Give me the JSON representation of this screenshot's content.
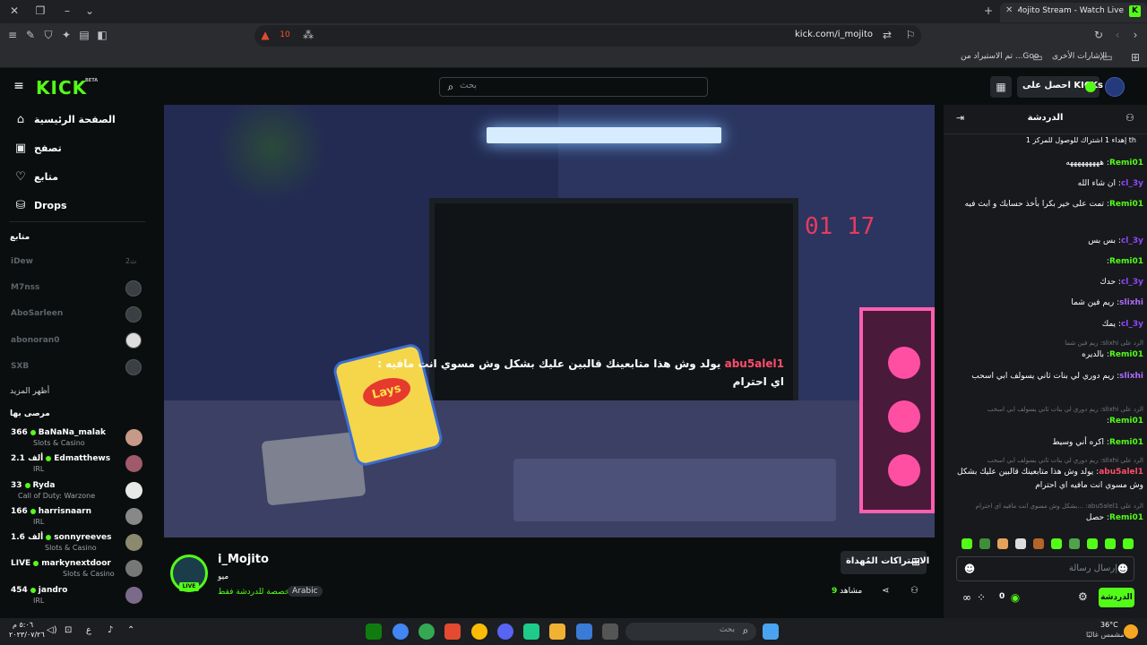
{
  "browser": {
    "tab_title": "i_Mojito Stream - Watch Live",
    "url": "kick.com/i_mojito",
    "shield_count": "10",
    "bookmarks": [
      "الإشارات الأخرى",
      "تم الاستيراد من ...Goo"
    ]
  },
  "header": {
    "logo": "KICK",
    "logo_badge": "BETA",
    "search_placeholder": "بحث",
    "get_kicks_label": "احصل على KICKs"
  },
  "sidebar": {
    "nav": [
      {
        "label": "الصفحة الرئيسية",
        "icon": "home-icon"
      },
      {
        "label": "تصفح",
        "icon": "browse-icon"
      },
      {
        "label": "متابع",
        "icon": "heart-icon"
      },
      {
        "label": "Drops",
        "icon": "drops-icon"
      }
    ],
    "following_heading": "متابع",
    "following": [
      {
        "name": "iDew",
        "status": "2ث"
      },
      {
        "name": "M7nss"
      },
      {
        "name": "AboSarleen"
      },
      {
        "name": "abonoran0"
      },
      {
        "name": "SXB"
      }
    ],
    "show_more": "أظهر المزيد",
    "recommended_heading": "مرصى بها",
    "recommended": [
      {
        "count": "366",
        "name": "BaNaNa_malak",
        "category": "Slots & Casino"
      },
      {
        "count": "2.1 ألف",
        "name": "Edmatthews",
        "category": "IRL"
      },
      {
        "count": "33",
        "name": "Ryda",
        "category": "Call of Duty: Warzone"
      },
      {
        "count": "166",
        "name": "harrisnaarn",
        "category": "IRL"
      },
      {
        "count": "1.6 ألف",
        "name": "sonnyreeves",
        "category": "Slots & Casino"
      },
      {
        "count": "LIVE",
        "name": "markynextdoor",
        "category": "Slots & Casino"
      },
      {
        "count": "454",
        "name": "jandro",
        "category": "IRL"
      }
    ]
  },
  "video": {
    "overlay_user": "abu5alel1",
    "overlay_text": "يولد وش هذا متابعينك قالبين عليك بشكل وش مسوي انت مافيه :",
    "overlay_text2": "اي احترام",
    "clock": "01 17",
    "chips_brand": "Lays"
  },
  "stream": {
    "name": "i_Mojito",
    "category": "ميو",
    "live_label": "LIVE",
    "chat_mode": "مخصصة للدردشة فقط",
    "language": "Arabic",
    "gift_label": "الاشتراكات المُهداة",
    "viewers_count": "9",
    "viewers_label": "مشاهد"
  },
  "chat": {
    "title": "الدردشة",
    "pinned": "th إهداء 1 اشتراك للوصول للمركز 1",
    "messages": [
      {
        "user": "Remi01",
        "color": "#53fc18",
        "text": "هههههههههه"
      },
      {
        "user": "cl_3y",
        "color": "#9147ff",
        "text": "ان شاء الله"
      },
      {
        "user": "Remi01",
        "color": "#53fc18",
        "text": "تمت على خير بكرا بأخذ حسابك و ابث فيه"
      },
      {
        "user": "cl_3y",
        "color": "#9147ff",
        "text": "بس بس"
      },
      {
        "user": "Remi01",
        "color": "#53fc18",
        "text": ""
      },
      {
        "user": "cl_3y",
        "color": "#9147ff",
        "text": "حدك"
      },
      {
        "user": "slixhi",
        "color": "#b06bff",
        "text": "ريم فين شما"
      },
      {
        "user": "cl_3y",
        "color": "#9147ff",
        "text": "يمك"
      },
      {
        "user": "Remi01",
        "color": "#53fc18",
        "text": "بالديره"
      },
      {
        "user": "slixhi",
        "color": "#b06bff",
        "text": "ريم دوري لي بنات ثاني يسولف ابي اسحب"
      },
      {
        "user": "Remi01",
        "color": "#53fc18",
        "text": ""
      },
      {
        "user": "Remi01",
        "color": "#53fc18",
        "text": "اكره أني وسيط"
      },
      {
        "user": "abu5alel1",
        "color": "#ff4d6b",
        "text": "يولد وش هذا متابعينك قالبين عليك بشكل وش مسوي انت مافيه اي احترام"
      },
      {
        "user": "Remi01",
        "color": "#53fc18",
        "text": "حصل"
      }
    ],
    "replies": [
      "الرد على slixhi: ريم فين شما",
      "الرد على slixhi: ريم دوري لي بنات ثاني يسولف ابي اسحب",
      "الرد على slixhi: ريم دوري لي بنات ثاني يسولف ابي اسحب",
      "الرد على abu5alel1: ...بشكل وش مسوي انت مافيه اي احترام"
    ],
    "input_placeholder": "إرسال رسالة",
    "send_label": "الدردشة",
    "kicks_balance": "0"
  },
  "taskbar": {
    "search_placeholder": "بحث",
    "weather_temp": "36°C",
    "weather_desc": "مشمس غالبًا",
    "time": "٥:٠٦ م",
    "date": "٢٠٢٣/٠٧/٢٦",
    "lang": "ع"
  }
}
